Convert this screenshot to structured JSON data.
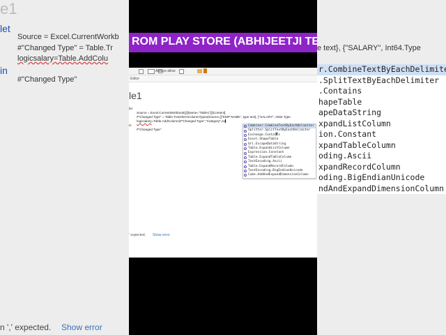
{
  "background": {
    "title_fragment": "e1",
    "code_left": {
      "let_kw": "let",
      "line1": "Source = Excel.CurrentWorkb",
      "line2": "#\"Changed Type\" = Table.Tr",
      "line3": "logicsalary=Table.AddColu",
      "in_kw": "in",
      "line5": "#\"Changed Type\""
    },
    "code_right_top": "e text}, {\"SALARY\", Int64.Type",
    "right_list": [
      "r.CombineTextByEachDelimiter",
      ".SplitTextByEachDelimiter",
      ".Contains",
      "hapeTable",
      "apeDataString",
      "xpandListColumn",
      "ion.Constant",
      "xpandTableColumn",
      "oding.Ascii",
      "xpandRecordColumn",
      "oding.BigEndianUnicode",
      "ndAndExpandDimensionColumn"
    ],
    "error_text": "n ',' expected.",
    "show_error": "Show error"
  },
  "banner": {
    "text": "ROM PLAY STORE (ABHIJEETJI TEC",
    "color": "#8e24c8"
  },
  "screen": {
    "ribbon": {
      "always_allow": "Always allow"
    },
    "subbar_label": "Editor",
    "query_title": "le1",
    "code": {
      "let_kw": "let",
      "line1": "Source = Excel.CurrentWorkbook(){[Name=\"Table1\"]}[Content],",
      "line2": "#\"Changed Type\" = Table.TransformColumnTypes(Source,{{\"EMP NAME\", type text}, {\"SALARY\", Int64.Type",
      "line3_a": "logicsalary",
      "line3_b": "=Table.AddColumn(#\"Changed Type\",\"Category\",ex",
      "in_kw": "in",
      "line5": "#\"Changed Type\""
    },
    "intellisense": [
      {
        "label": "Combiner.CombineTextByEachDelimiter",
        "selected": true
      },
      {
        "label": "Splitter.SplitTextByEachDelimiter",
        "selected": false
      },
      {
        "label": "Exchange.Contains",
        "selected": false
      },
      {
        "label": "Excel.ShapeTable",
        "selected": false
      },
      {
        "label": "Uri.EscapeDataString",
        "selected": false
      },
      {
        "label": "Table.ExpandListColumn",
        "selected": false
      },
      {
        "label": "Expression.Constant",
        "selected": false
      },
      {
        "label": "Table.ExpandTableColumn",
        "selected": false
      },
      {
        "label": "TextEncoding.Ascii",
        "selected": false
      },
      {
        "label": "Table.ExpandRecordColumn",
        "selected": false
      },
      {
        "label": "TextEncoding.BigEndianUnicode",
        "selected": false
      },
      {
        "label": "Cube.AddAndExpandDimensionColumn",
        "selected": false
      }
    ],
    "status": {
      "error_text": "' expected.",
      "show_error": "Show error"
    }
  }
}
